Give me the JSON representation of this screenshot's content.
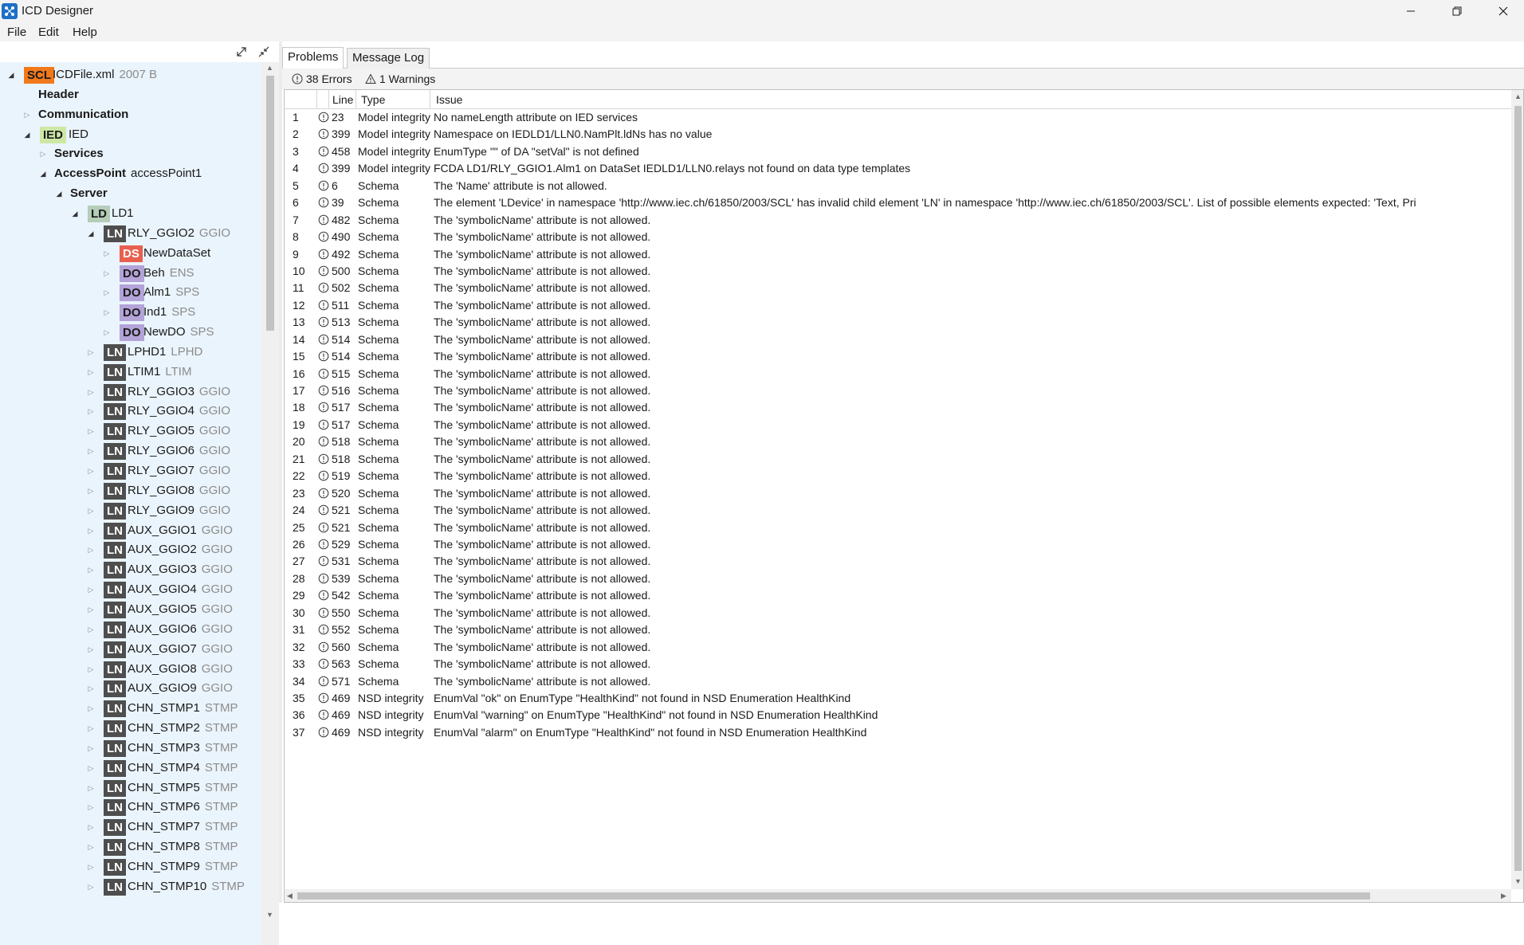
{
  "window": {
    "title": "ICD Designer"
  },
  "menu": [
    "File",
    "Edit",
    "Help"
  ],
  "tree": [
    {
      "indent": 0,
      "expander": "expanded",
      "badge": "SCL",
      "name": "ICDFile.xml",
      "sub": "2007 B",
      "bold": false
    },
    {
      "indent": 1,
      "expander": "none",
      "badge": "",
      "name": "Header",
      "sub": "",
      "bold": true
    },
    {
      "indent": 1,
      "expander": "collapsed",
      "badge": "",
      "name": "Communication",
      "sub": "",
      "bold": true
    },
    {
      "indent": 1,
      "expander": "expanded",
      "badge": "IED",
      "name": "IED",
      "sub": "",
      "bold": false
    },
    {
      "indent": 2,
      "expander": "collapsed",
      "badge": "",
      "name": "Services",
      "sub": "",
      "bold": true
    },
    {
      "indent": 2,
      "expander": "expanded",
      "badge": "",
      "name": "AccessPoint",
      "sub": "accessPoint1",
      "bold": true
    },
    {
      "indent": 3,
      "expander": "expanded",
      "badge": "",
      "name": "Server",
      "sub": "",
      "bold": true
    },
    {
      "indent": 4,
      "expander": "expanded",
      "badge": "LD",
      "name": "LD1",
      "sub": "",
      "bold": false
    },
    {
      "indent": 5,
      "expander": "expanded",
      "badge": "LN",
      "name": "RLY_GGIO2",
      "sub": "GGIO",
      "bold": false
    },
    {
      "indent": 6,
      "expander": "collapsed",
      "badge": "DS",
      "name": "NewDataSet",
      "sub": "",
      "bold": false
    },
    {
      "indent": 6,
      "expander": "collapsed",
      "badge": "DO",
      "name": "Beh",
      "sub": "ENS",
      "bold": false
    },
    {
      "indent": 6,
      "expander": "collapsed",
      "badge": "DO",
      "name": "Alm1",
      "sub": "SPS",
      "bold": false
    },
    {
      "indent": 6,
      "expander": "collapsed",
      "badge": "DO",
      "name": "Ind1",
      "sub": "SPS",
      "bold": false
    },
    {
      "indent": 6,
      "expander": "collapsed",
      "badge": "DO",
      "name": "NewDO",
      "sub": "SPS",
      "bold": false
    },
    {
      "indent": 5,
      "expander": "collapsed",
      "badge": "LN",
      "name": "LPHD1",
      "sub": "LPHD",
      "bold": false
    },
    {
      "indent": 5,
      "expander": "collapsed",
      "badge": "LN",
      "name": "LTIM1",
      "sub": "LTIM",
      "bold": false
    },
    {
      "indent": 5,
      "expander": "collapsed",
      "badge": "LN",
      "name": "RLY_GGIO3",
      "sub": "GGIO",
      "bold": false
    },
    {
      "indent": 5,
      "expander": "collapsed",
      "badge": "LN",
      "name": "RLY_GGIO4",
      "sub": "GGIO",
      "bold": false
    },
    {
      "indent": 5,
      "expander": "collapsed",
      "badge": "LN",
      "name": "RLY_GGIO5",
      "sub": "GGIO",
      "bold": false
    },
    {
      "indent": 5,
      "expander": "collapsed",
      "badge": "LN",
      "name": "RLY_GGIO6",
      "sub": "GGIO",
      "bold": false
    },
    {
      "indent": 5,
      "expander": "collapsed",
      "badge": "LN",
      "name": "RLY_GGIO7",
      "sub": "GGIO",
      "bold": false
    },
    {
      "indent": 5,
      "expander": "collapsed",
      "badge": "LN",
      "name": "RLY_GGIO8",
      "sub": "GGIO",
      "bold": false
    },
    {
      "indent": 5,
      "expander": "collapsed",
      "badge": "LN",
      "name": "RLY_GGIO9",
      "sub": "GGIO",
      "bold": false
    },
    {
      "indent": 5,
      "expander": "collapsed",
      "badge": "LN",
      "name": "AUX_GGIO1",
      "sub": "GGIO",
      "bold": false
    },
    {
      "indent": 5,
      "expander": "collapsed",
      "badge": "LN",
      "name": "AUX_GGIO2",
      "sub": "GGIO",
      "bold": false
    },
    {
      "indent": 5,
      "expander": "collapsed",
      "badge": "LN",
      "name": "AUX_GGIO3",
      "sub": "GGIO",
      "bold": false
    },
    {
      "indent": 5,
      "expander": "collapsed",
      "badge": "LN",
      "name": "AUX_GGIO4",
      "sub": "GGIO",
      "bold": false
    },
    {
      "indent": 5,
      "expander": "collapsed",
      "badge": "LN",
      "name": "AUX_GGIO5",
      "sub": "GGIO",
      "bold": false
    },
    {
      "indent": 5,
      "expander": "collapsed",
      "badge": "LN",
      "name": "AUX_GGIO6",
      "sub": "GGIO",
      "bold": false
    },
    {
      "indent": 5,
      "expander": "collapsed",
      "badge": "LN",
      "name": "AUX_GGIO7",
      "sub": "GGIO",
      "bold": false
    },
    {
      "indent": 5,
      "expander": "collapsed",
      "badge": "LN",
      "name": "AUX_GGIO8",
      "sub": "GGIO",
      "bold": false
    },
    {
      "indent": 5,
      "expander": "collapsed",
      "badge": "LN",
      "name": "AUX_GGIO9",
      "sub": "GGIO",
      "bold": false
    },
    {
      "indent": 5,
      "expander": "collapsed",
      "badge": "LN",
      "name": "CHN_STMP1",
      "sub": "STMP",
      "bold": false
    },
    {
      "indent": 5,
      "expander": "collapsed",
      "badge": "LN",
      "name": "CHN_STMP2",
      "sub": "STMP",
      "bold": false
    },
    {
      "indent": 5,
      "expander": "collapsed",
      "badge": "LN",
      "name": "CHN_STMP3",
      "sub": "STMP",
      "bold": false
    },
    {
      "indent": 5,
      "expander": "collapsed",
      "badge": "LN",
      "name": "CHN_STMP4",
      "sub": "STMP",
      "bold": false
    },
    {
      "indent": 5,
      "expander": "collapsed",
      "badge": "LN",
      "name": "CHN_STMP5",
      "sub": "STMP",
      "bold": false
    },
    {
      "indent": 5,
      "expander": "collapsed",
      "badge": "LN",
      "name": "CHN_STMP6",
      "sub": "STMP",
      "bold": false
    },
    {
      "indent": 5,
      "expander": "collapsed",
      "badge": "LN",
      "name": "CHN_STMP7",
      "sub": "STMP",
      "bold": false
    },
    {
      "indent": 5,
      "expander": "collapsed",
      "badge": "LN",
      "name": "CHN_STMP8",
      "sub": "STMP",
      "bold": false
    },
    {
      "indent": 5,
      "expander": "collapsed",
      "badge": "LN",
      "name": "CHN_STMP9",
      "sub": "STMP",
      "bold": false
    },
    {
      "indent": 5,
      "expander": "collapsed",
      "badge": "LN",
      "name": "CHN_STMP10",
      "sub": "STMP",
      "bold": false
    }
  ],
  "problems": {
    "tabs": [
      {
        "label": "Problems",
        "active": true
      },
      {
        "label": "Message Log",
        "active": false
      }
    ],
    "errors_label": "38 Errors",
    "warnings_label": "1 Warnings",
    "columns": {
      "num": "",
      "icon": "",
      "line": "Line",
      "type": "Type",
      "issue": "Issue"
    },
    "rows": [
      {
        "num": "1",
        "line": "23",
        "type": "Model integrity",
        "issue": "No nameLength attribute on IED services"
      },
      {
        "num": "2",
        "line": "399",
        "type": "Model integrity",
        "issue": "Namespace on IEDLD1/LLN0.NamPlt.ldNs has no value"
      },
      {
        "num": "3",
        "line": "458",
        "type": "Model integrity",
        "issue": "EnumType \"\" of DA \"setVal\" is not defined"
      },
      {
        "num": "4",
        "line": "399",
        "type": "Model integrity",
        "issue": "FCDA LD1/RLY_GGIO1.Alm1 on DataSet IEDLD1/LLN0.relays not found on data type templates"
      },
      {
        "num": "5",
        "line": "6",
        "type": "Schema",
        "issue": "The 'Name' attribute is not allowed."
      },
      {
        "num": "6",
        "line": "39",
        "type": "Schema",
        "issue": "The element 'LDevice' in namespace 'http://www.iec.ch/61850/2003/SCL' has invalid child element 'LN' in namespace 'http://www.iec.ch/61850/2003/SCL'. List of possible elements expected: 'Text, Pri"
      },
      {
        "num": "7",
        "line": "482",
        "type": "Schema",
        "issue": "The 'symbolicName' attribute is not allowed."
      },
      {
        "num": "8",
        "line": "490",
        "type": "Schema",
        "issue": "The 'symbolicName' attribute is not allowed."
      },
      {
        "num": "9",
        "line": "492",
        "type": "Schema",
        "issue": "The 'symbolicName' attribute is not allowed."
      },
      {
        "num": "10",
        "line": "500",
        "type": "Schema",
        "issue": "The 'symbolicName' attribute is not allowed."
      },
      {
        "num": "11",
        "line": "502",
        "type": "Schema",
        "issue": "The 'symbolicName' attribute is not allowed."
      },
      {
        "num": "12",
        "line": "511",
        "type": "Schema",
        "issue": "The 'symbolicName' attribute is not allowed."
      },
      {
        "num": "13",
        "line": "513",
        "type": "Schema",
        "issue": "The 'symbolicName' attribute is not allowed."
      },
      {
        "num": "14",
        "line": "514",
        "type": "Schema",
        "issue": "The 'symbolicName' attribute is not allowed."
      },
      {
        "num": "15",
        "line": "514",
        "type": "Schema",
        "issue": "The 'symbolicName' attribute is not allowed."
      },
      {
        "num": "16",
        "line": "515",
        "type": "Schema",
        "issue": "The 'symbolicName' attribute is not allowed."
      },
      {
        "num": "17",
        "line": "516",
        "type": "Schema",
        "issue": "The 'symbolicName' attribute is not allowed."
      },
      {
        "num": "18",
        "line": "517",
        "type": "Schema",
        "issue": "The 'symbolicName' attribute is not allowed."
      },
      {
        "num": "19",
        "line": "517",
        "type": "Schema",
        "issue": "The 'symbolicName' attribute is not allowed."
      },
      {
        "num": "20",
        "line": "518",
        "type": "Schema",
        "issue": "The 'symbolicName' attribute is not allowed."
      },
      {
        "num": "21",
        "line": "518",
        "type": "Schema",
        "issue": "The 'symbolicName' attribute is not allowed."
      },
      {
        "num": "22",
        "line": "519",
        "type": "Schema",
        "issue": "The 'symbolicName' attribute is not allowed."
      },
      {
        "num": "23",
        "line": "520",
        "type": "Schema",
        "issue": "The 'symbolicName' attribute is not allowed."
      },
      {
        "num": "24",
        "line": "521",
        "type": "Schema",
        "issue": "The 'symbolicName' attribute is not allowed."
      },
      {
        "num": "25",
        "line": "521",
        "type": "Schema",
        "issue": "The 'symbolicName' attribute is not allowed."
      },
      {
        "num": "26",
        "line": "529",
        "type": "Schema",
        "issue": "The 'symbolicName' attribute is not allowed."
      },
      {
        "num": "27",
        "line": "531",
        "type": "Schema",
        "issue": "The 'symbolicName' attribute is not allowed."
      },
      {
        "num": "28",
        "line": "539",
        "type": "Schema",
        "issue": "The 'symbolicName' attribute is not allowed."
      },
      {
        "num": "29",
        "line": "542",
        "type": "Schema",
        "issue": "The 'symbolicName' attribute is not allowed."
      },
      {
        "num": "30",
        "line": "550",
        "type": "Schema",
        "issue": "The 'symbolicName' attribute is not allowed."
      },
      {
        "num": "31",
        "line": "552",
        "type": "Schema",
        "issue": "The 'symbolicName' attribute is not allowed."
      },
      {
        "num": "32",
        "line": "560",
        "type": "Schema",
        "issue": "The 'symbolicName' attribute is not allowed."
      },
      {
        "num": "33",
        "line": "563",
        "type": "Schema",
        "issue": "The 'symbolicName' attribute is not allowed."
      },
      {
        "num": "34",
        "line": "571",
        "type": "Schema",
        "issue": "The 'symbolicName' attribute is not allowed."
      },
      {
        "num": "35",
        "line": "469",
        "type": "NSD integrity",
        "issue": "EnumVal \"ok\" on EnumType \"HealthKind\"  not found in NSD Enumeration HealthKind"
      },
      {
        "num": "36",
        "line": "469",
        "type": "NSD integrity",
        "issue": "EnumVal \"warning\" on EnumType \"HealthKind\"  not found in NSD Enumeration HealthKind"
      },
      {
        "num": "37",
        "line": "469",
        "type": "NSD integrity",
        "issue": "EnumVal \"alarm\" on EnumType \"HealthKind\"  not found in NSD Enumeration HealthKind"
      }
    ]
  },
  "colors": {
    "tree_background": "#eaf4fc",
    "app_icon": "#1e6fc7",
    "scl_badge": "#f0791b",
    "ied_badge": "#cde8a5",
    "ld_badge": "#b4cdb8",
    "ln_badge": "#4e4e4e",
    "ds_badge": "#e8604f",
    "do_badge": "#b3a3d8"
  }
}
